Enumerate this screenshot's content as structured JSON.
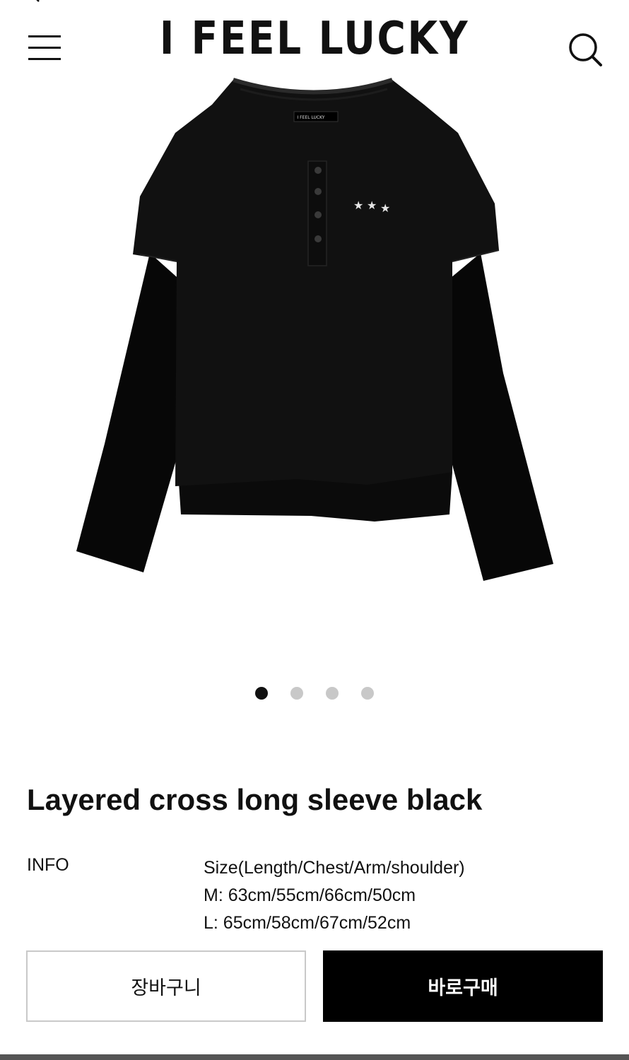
{
  "header": {
    "brand": "I FEEL LUCKY"
  },
  "product": {
    "image_tag_text": "I FEEL LUCKY",
    "carousel": {
      "total": 4,
      "active": 1
    },
    "title": "Layered cross long sleeve black",
    "info": {
      "label": "INFO",
      "lines": [
        "Size(Length/Chest/Arm/shoulder)",
        "M: 63cm/55cm/66cm/50cm",
        "L: 65cm/58cm/67cm/52cm"
      ]
    }
  },
  "actions": {
    "cart_label": "장바구니",
    "buy_label": "바로구매"
  },
  "icons": {
    "back": "chevron-left-icon",
    "menu": "hamburger-menu-icon",
    "search": "search-icon"
  },
  "colors": {
    "primary": "#000000",
    "dot_active": "#111111",
    "dot_inactive": "#c8c8c8",
    "cart_border": "#c9c9c9"
  }
}
